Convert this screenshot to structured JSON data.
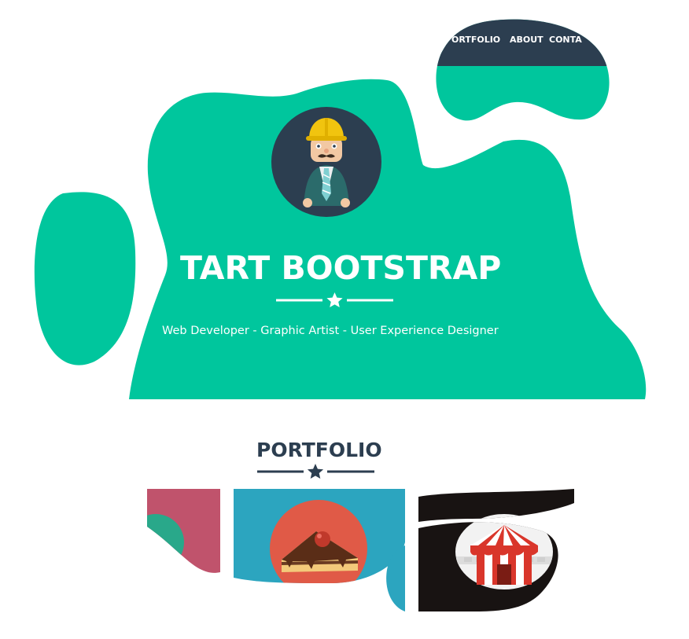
{
  "nav": {
    "items": [
      {
        "label": "PORTFOLIO",
        "shown": "ORTFOLIO"
      },
      {
        "label": "ABOUT",
        "shown": "ABOUT"
      },
      {
        "label": "CONTACT",
        "shown": "CONTA"
      }
    ]
  },
  "hero": {
    "title": "START BOOTSTRAP",
    "title_shown": "TART BOOTSTRAP",
    "subtitle": "Web Developer - Graphic Artist - User Experience Designer",
    "avatar_icon": "construction-worker-avatar-icon",
    "divider_icon": "star-icon"
  },
  "portfolio": {
    "heading": "PORTFOLIO",
    "divider_icon": "star-icon",
    "items": [
      {
        "icon": "cabin-icon",
        "bg": "#c0536c"
      },
      {
        "icon": "cake-icon",
        "bg": "#2ca5bf"
      },
      {
        "icon": "circus-tent-icon",
        "bg": "#181312"
      }
    ]
  },
  "colors": {
    "primary": "#1abc9c",
    "hero_green": "#00c69d",
    "navy": "#2c3e50",
    "text_dark": "#2c3e50"
  }
}
